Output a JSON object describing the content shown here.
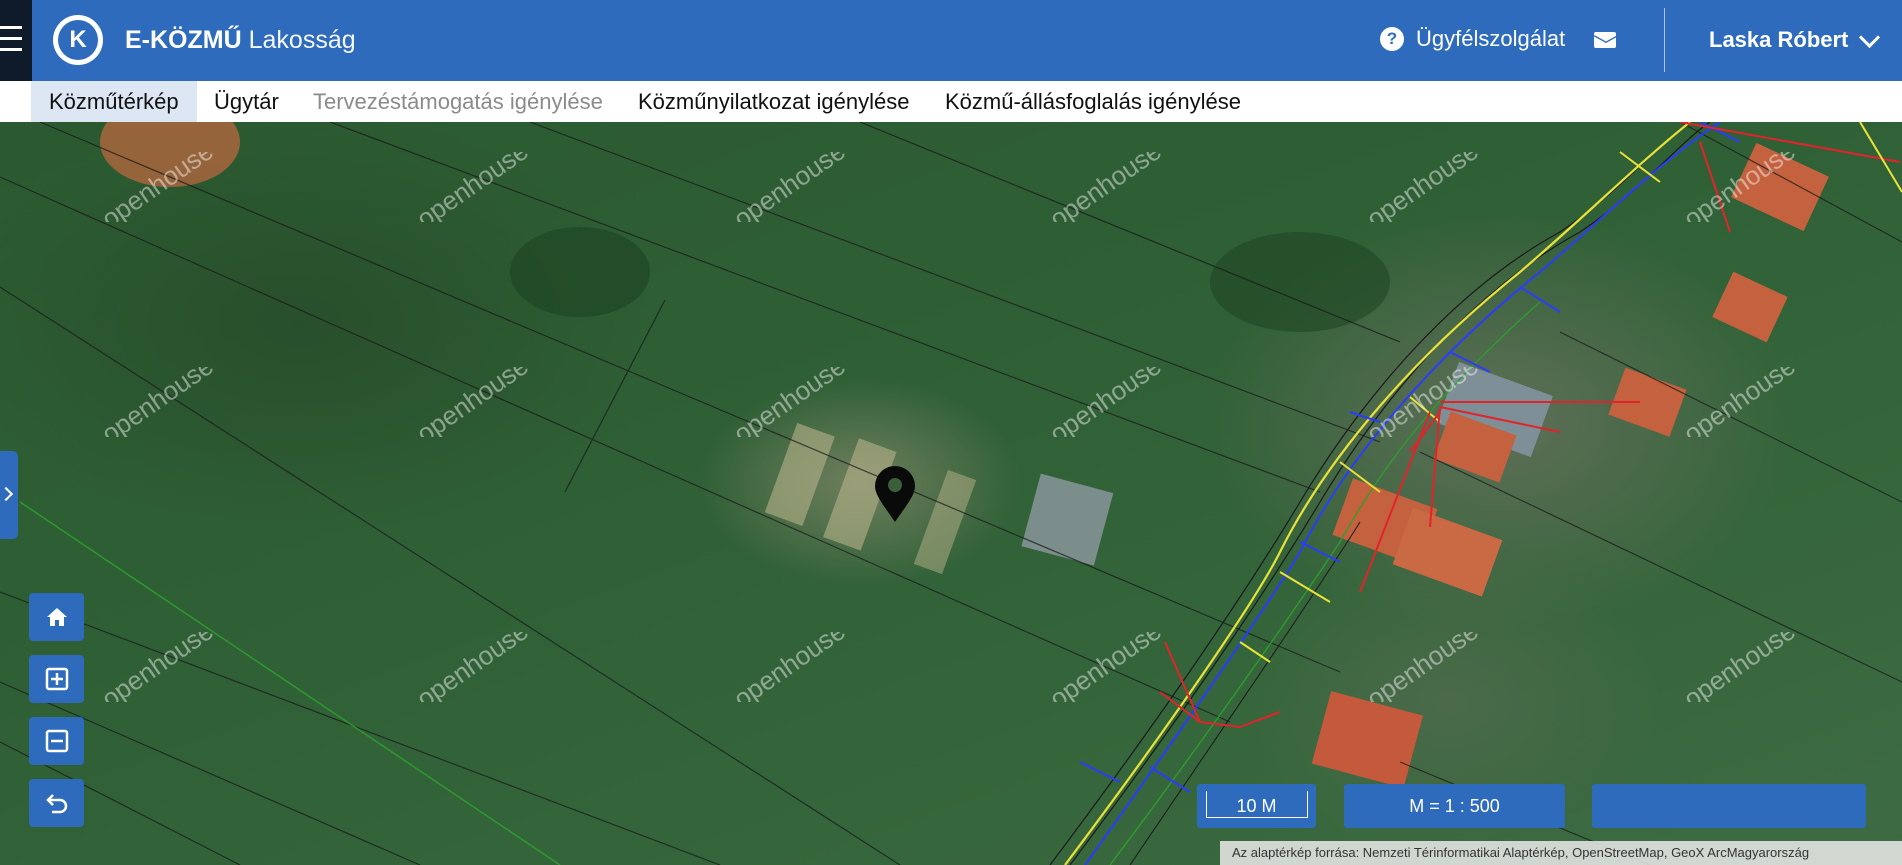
{
  "app": {
    "logo_letter": "K",
    "brand_bold": "E-KÖZMŰ",
    "brand_light": "Lakosság",
    "help_label": "Ügyfélszolgálat",
    "user_name": "Laska Róbert"
  },
  "nav": {
    "items": [
      {
        "label": "Közműtérkép",
        "state": "active"
      },
      {
        "label": "Ügytár",
        "state": "normal"
      },
      {
        "label": "Tervezéstámogatás igénylése",
        "state": "disabled"
      },
      {
        "label": "Közműnyilatkozat igénylése",
        "state": "normal"
      },
      {
        "label": "Közmű-állásfoglalás igénylése",
        "state": "normal"
      }
    ]
  },
  "map": {
    "scale_bar_label": "10 M",
    "scale_ratio": "M = 1 : 500",
    "coordinates_box": "",
    "attribution": "Az alaptérkép forrása: Nemzeti Térinformatikai Alaptérkép, OpenStreetMap, GeoX ArcMagyarország",
    "watermark_text": "openhouse",
    "marker_icon": "map-pin-icon",
    "tools": [
      {
        "name": "home-icon",
        "label": "home"
      },
      {
        "name": "zoom-in-icon",
        "label": "zoom in"
      },
      {
        "name": "zoom-out-icon",
        "label": "zoom out"
      },
      {
        "name": "undo-icon",
        "label": "undo"
      }
    ],
    "colors": {
      "utility_yellow": "#e8e23a",
      "utility_blue": "#2a3cff",
      "utility_red": "#e3232a",
      "utility_green": "#2ca02c",
      "parcel_line": "#1a1a1a",
      "accent": "#2e6bbd"
    }
  }
}
